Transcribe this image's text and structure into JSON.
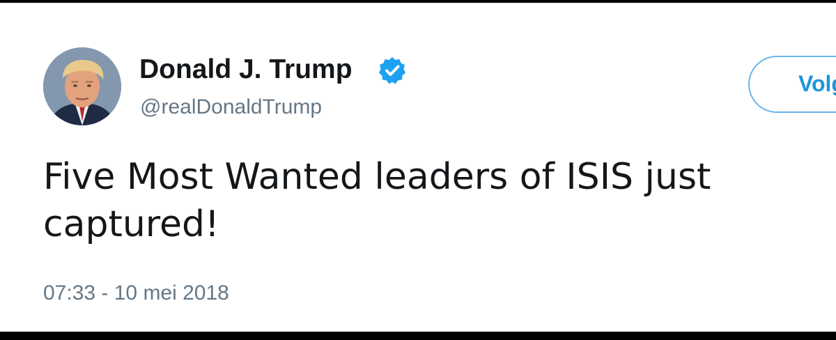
{
  "tweet": {
    "author": {
      "display_name": "Donald J. Trump",
      "handle": "@realDonaldTrump",
      "verified": true,
      "verified_icon": "verified-badge-icon"
    },
    "follow_button": {
      "label": "Volg"
    },
    "text": "Five Most Wanted leaders of ISIS just captured!",
    "timestamp": "07:33 - 10 mei 2018"
  },
  "colors": {
    "text_primary": "#14171a",
    "text_secondary": "#657786",
    "accent": "#1b95e0",
    "verified": "#1da1f2"
  }
}
